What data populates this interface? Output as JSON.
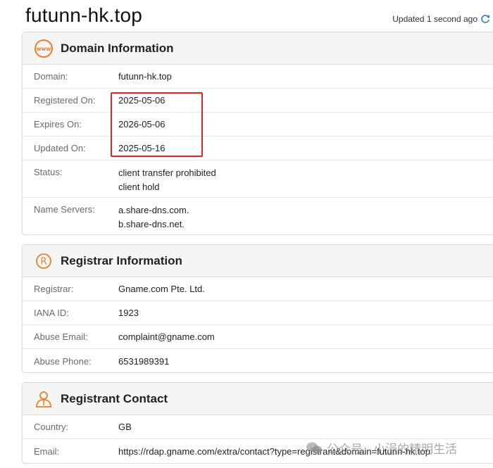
{
  "page": {
    "title": "futunn-hk.top",
    "updated_text": "Updated 1 second ago"
  },
  "domain_info": {
    "title": "Domain Information",
    "icon": "www-icon",
    "rows": [
      {
        "label": "Domain:",
        "values": [
          "futunn-hk.top"
        ]
      },
      {
        "label": "Registered On:",
        "values": [
          "2025-05-06"
        ]
      },
      {
        "label": "Expires On:",
        "values": [
          "2026-05-06"
        ]
      },
      {
        "label": "Updated On:",
        "values": [
          "2025-05-16"
        ]
      },
      {
        "label": "Status:",
        "values": [
          "client transfer prohibited",
          "client hold"
        ]
      },
      {
        "label": "Name Servers:",
        "values": [
          "a.share-dns.com.",
          "b.share-dns.net."
        ]
      }
    ]
  },
  "registrar_info": {
    "title": "Registrar Information",
    "icon": "registered-icon",
    "rows": [
      {
        "label": "Registrar:",
        "value": "Gname.com Pte. Ltd."
      },
      {
        "label": "IANA ID:",
        "value": "1923"
      },
      {
        "label": "Abuse Email:",
        "value": "complaint@gname.com"
      },
      {
        "label": "Abuse Phone:",
        "value": "6531989391"
      }
    ]
  },
  "registrant_contact": {
    "title": "Registrant Contact",
    "icon": "person-icon",
    "rows": [
      {
        "label": "Country:",
        "value": "GB"
      },
      {
        "label": "Email:",
        "value": "https://rdap.gname.com/extra/contact?type=registrant&domain=futunn-hk.top"
      }
    ]
  },
  "watermark": {
    "text": "公众号 · 小涓的精明生活"
  },
  "colors": {
    "accent_orange": "#e8802e",
    "highlight_red": "#d9262b",
    "refresh_blue": "#2a7fd4"
  }
}
